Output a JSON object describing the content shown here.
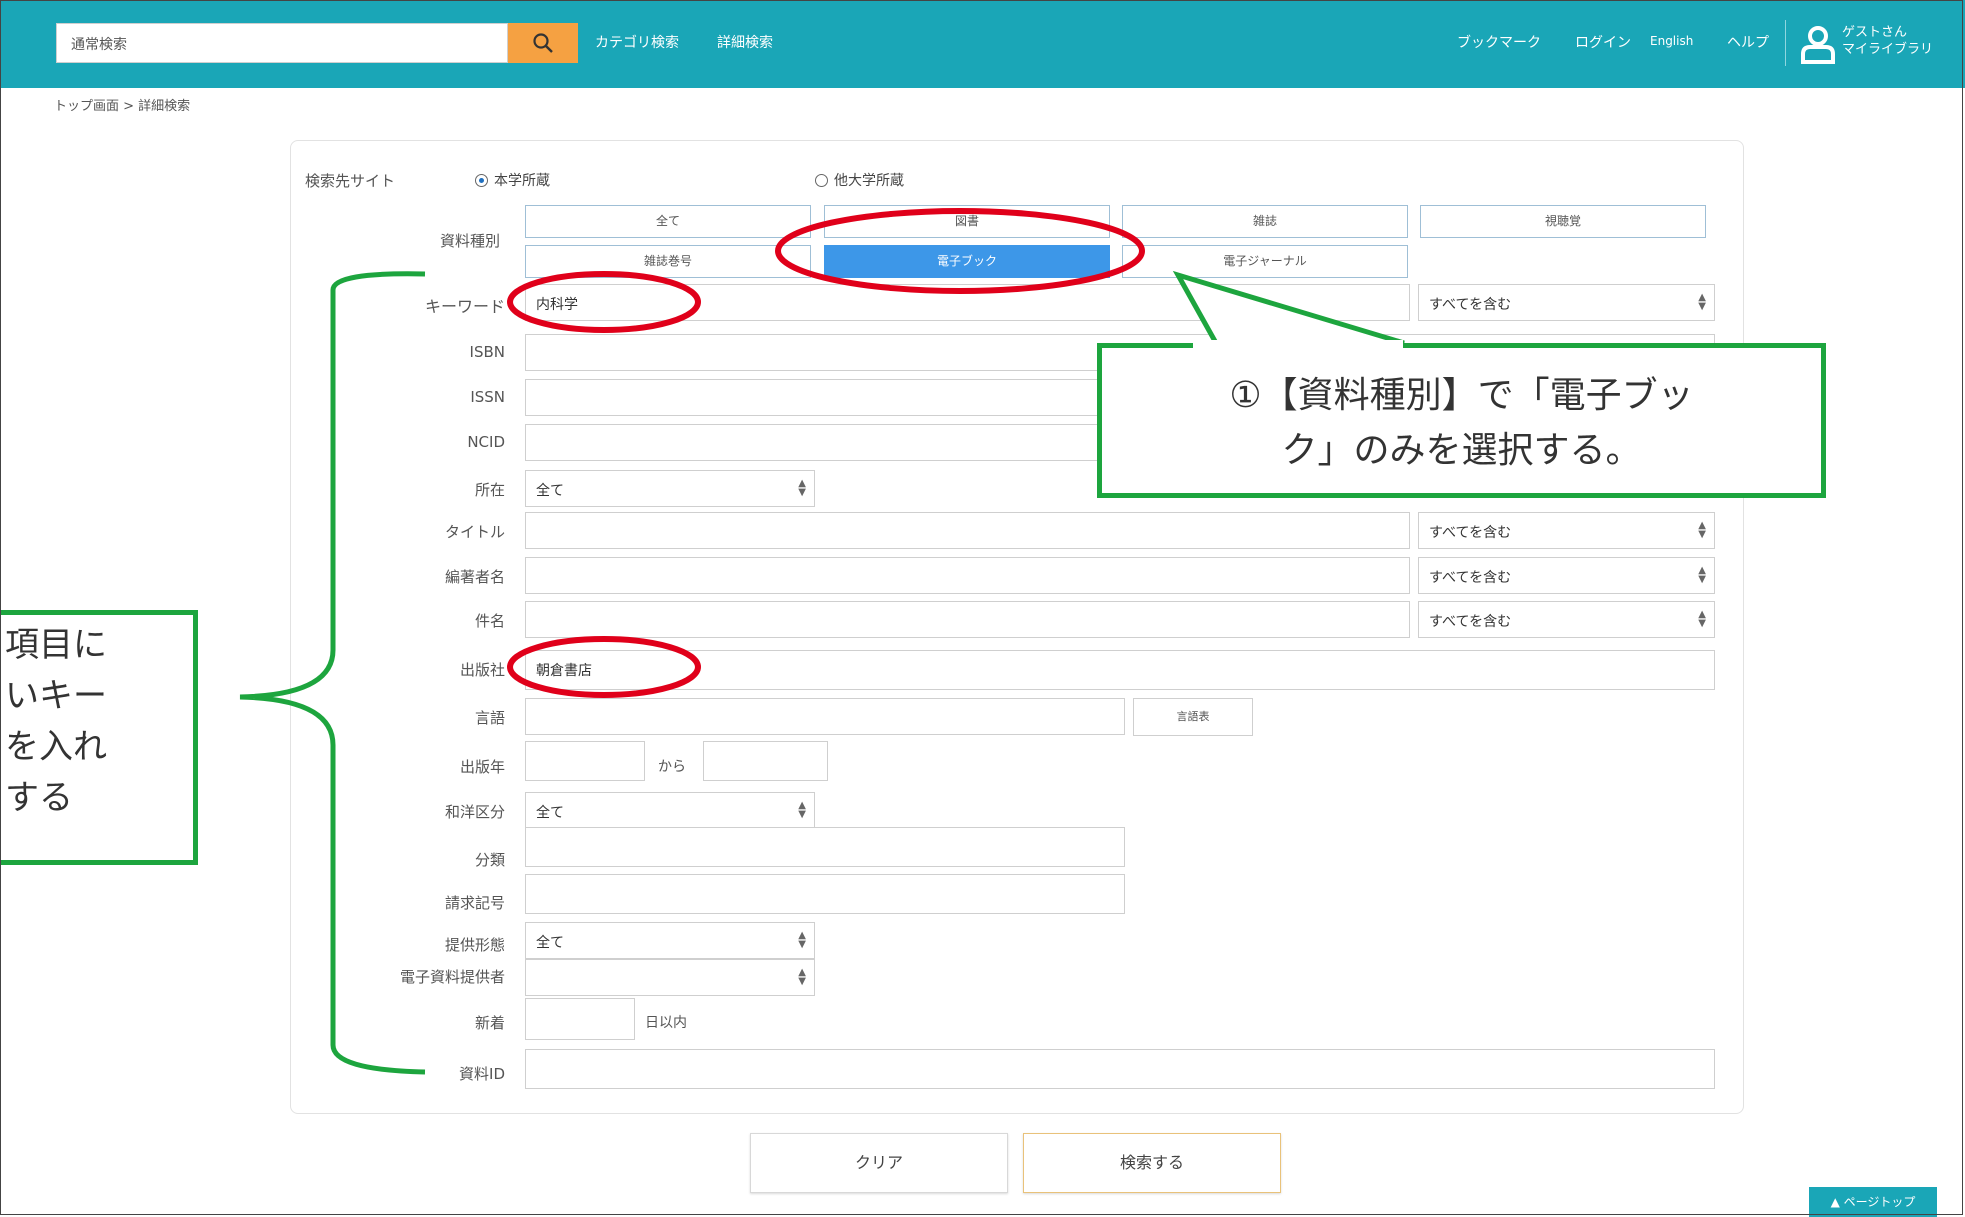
{
  "header": {
    "search_placeholder": "通常検索",
    "category_search": "カテゴリ検索",
    "advanced_search": "詳細検索",
    "bookmark": "ブックマーク",
    "login": "ログイン",
    "english": "English",
    "help": "ヘルプ",
    "user_name": "ゲストさん",
    "my_library": "マイライブラリ",
    "color": "#1aa6b7",
    "search_button_color": "#f5a142",
    "search_icon": "search-icon",
    "user_icon": "user-icon"
  },
  "breadcrumb": "トップ画面 > 詳細検索",
  "form": {
    "site_label": "検索先サイト",
    "site_options": [
      "本学所蔵",
      "他大学所蔵"
    ],
    "site_selected": "本学所蔵",
    "type_label": "資料種別",
    "type_buttons": [
      "全て",
      "図書",
      "雑誌",
      "視聴覚",
      "雑誌巻号",
      "電子ブック",
      "電子ジャーナル"
    ],
    "type_selected": "電子ブック",
    "keyword_label": "キーワード",
    "keyword_value": "内科学",
    "match_option": "すべてを含む",
    "isbn_label": "ISBN",
    "issn_label": "ISSN",
    "ncid_label": "NCID",
    "location_label": "所在",
    "all_option": "全て",
    "title_label": "タイトル",
    "author_label": "編著者名",
    "subject_label": "件名",
    "publisher_label": "出版社",
    "publisher_value": "朝倉書店",
    "language_label": "言語",
    "language_button": "言語表",
    "year_label": "出版年",
    "year_from": "から",
    "jp_foreign_label": "和洋区分",
    "classification_label": "分類",
    "call_number_label": "請求記号",
    "format_label": "提供形態",
    "provider_label": "電子資料提供者",
    "new_arrivals_label": "新着",
    "new_arrivals_suffix": "日以内",
    "material_id_label": "資料ID",
    "clear_button": "クリア",
    "search_button": "検索する"
  },
  "page_top": "ページトップ",
  "annotations": {
    "callout1_line1": "①【資料種別】で「電子ブッ",
    "callout1_line2": "ク」のみを選択する。",
    "callout2_lines": [
      "項目に",
      "いキー",
      "を入れ",
      "する"
    ],
    "accent_green": "#1da53e",
    "circle_red": "#e0001a"
  }
}
